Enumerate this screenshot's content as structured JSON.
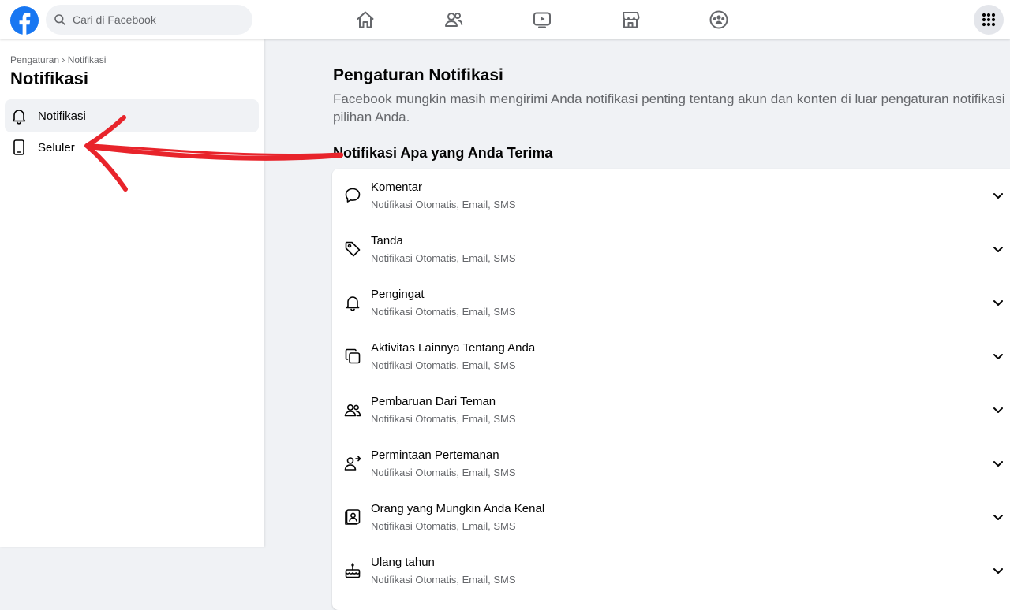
{
  "topbar": {
    "search_placeholder": "Cari di Facebook",
    "brand_color": "#1877f2"
  },
  "sidebar": {
    "breadcrumb": "Pengaturan › Notifikasi",
    "title": "Notifikasi",
    "items": [
      {
        "label": "Notifikasi",
        "icon": "bell-icon",
        "active": true
      },
      {
        "label": "Seluler",
        "icon": "mobile-phone-icon",
        "active": false
      }
    ]
  },
  "main": {
    "title": "Pengaturan Notifikasi",
    "description": "Facebook mungkin masih mengirimi Anda notifikasi penting tentang akun dan konten di luar pengaturan notifikasi pilihan Anda.",
    "section_title": "Notifikasi Apa yang Anda Terima",
    "rows": [
      {
        "title": "Komentar",
        "subtitle": "Notifikasi Otomatis, Email, SMS",
        "icon": "comment-icon"
      },
      {
        "title": "Tanda",
        "subtitle": "Notifikasi Otomatis, Email, SMS",
        "icon": "tag-icon"
      },
      {
        "title": "Pengingat",
        "subtitle": "Notifikasi Otomatis, Email, SMS",
        "icon": "bell-icon"
      },
      {
        "title": "Aktivitas Lainnya Tentang Anda",
        "subtitle": "Notifikasi Otomatis, Email, SMS",
        "icon": "stacked-squares-icon"
      },
      {
        "title": "Pembaruan Dari Teman",
        "subtitle": "Notifikasi Otomatis, Email, SMS",
        "icon": "friends-icon"
      },
      {
        "title": "Permintaan Pertemanan",
        "subtitle": "Notifikasi Otomatis, Email, SMS",
        "icon": "person-arrow-icon"
      },
      {
        "title": "Orang yang Mungkin Anda Kenal",
        "subtitle": "Notifikasi Otomatis, Email, SMS",
        "icon": "contact-card-icon"
      },
      {
        "title": "Ulang tahun",
        "subtitle": "Notifikasi Otomatis, Email, SMS",
        "icon": "birthday-cake-icon"
      }
    ]
  },
  "annotation": {
    "color": "#e8242b",
    "icon": "red-arrow-annotation"
  }
}
